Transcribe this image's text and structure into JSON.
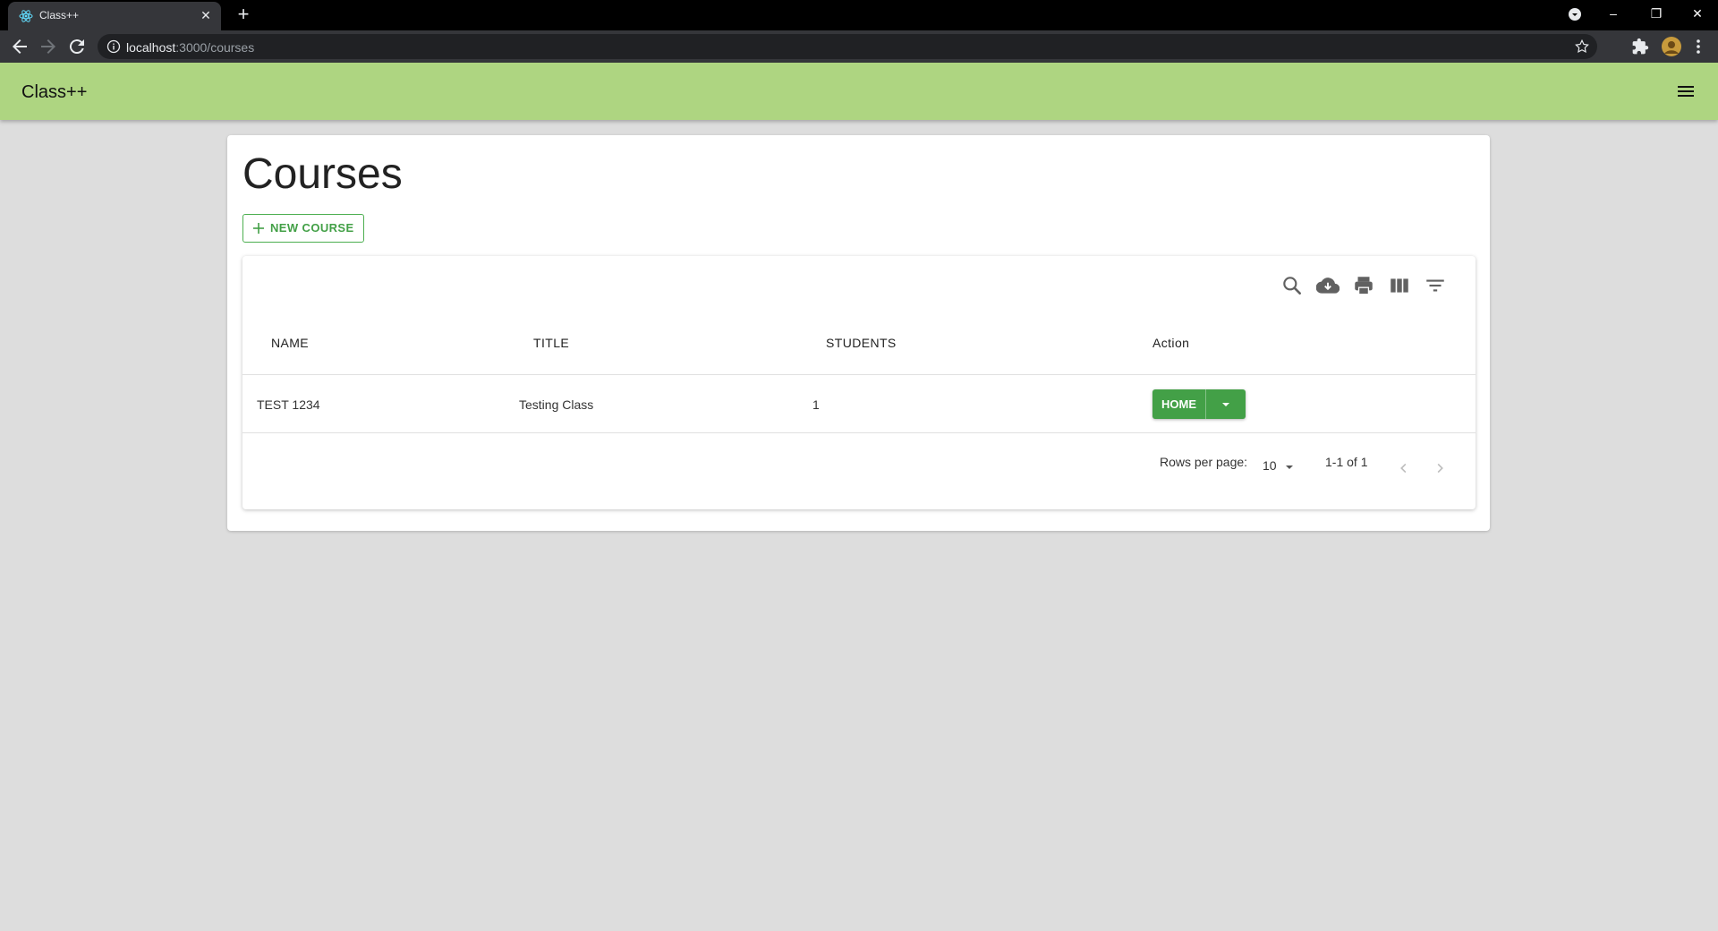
{
  "browser": {
    "tab_title": "Class++",
    "tab_close": "✕",
    "new_tab": "+",
    "url_host": "localhost",
    "url_path": ":3000/courses",
    "window_controls": [
      "–",
      "❐",
      "✕"
    ]
  },
  "appbar": {
    "brand": "Class++",
    "background": "#aed581"
  },
  "page": {
    "title": "Courses",
    "new_course_label": "NEW COURSE"
  },
  "table": {
    "toolbar_icons": [
      "search-icon",
      "download-icon",
      "print-icon",
      "view-columns-icon",
      "filter-icon"
    ],
    "columns": [
      "NAME",
      "TITLE",
      "STUDENTS",
      "Action"
    ],
    "rows": [
      {
        "name": "TEST 1234",
        "title": "Testing Class",
        "students": "1",
        "action_label": "HOME"
      }
    ],
    "rows_per_page_label": "Rows per page:",
    "rows_per_page_value": "10",
    "range_label": "1-1 of 1"
  },
  "colors": {
    "accent_green": "#43a047",
    "page_background": "#dddddd"
  }
}
